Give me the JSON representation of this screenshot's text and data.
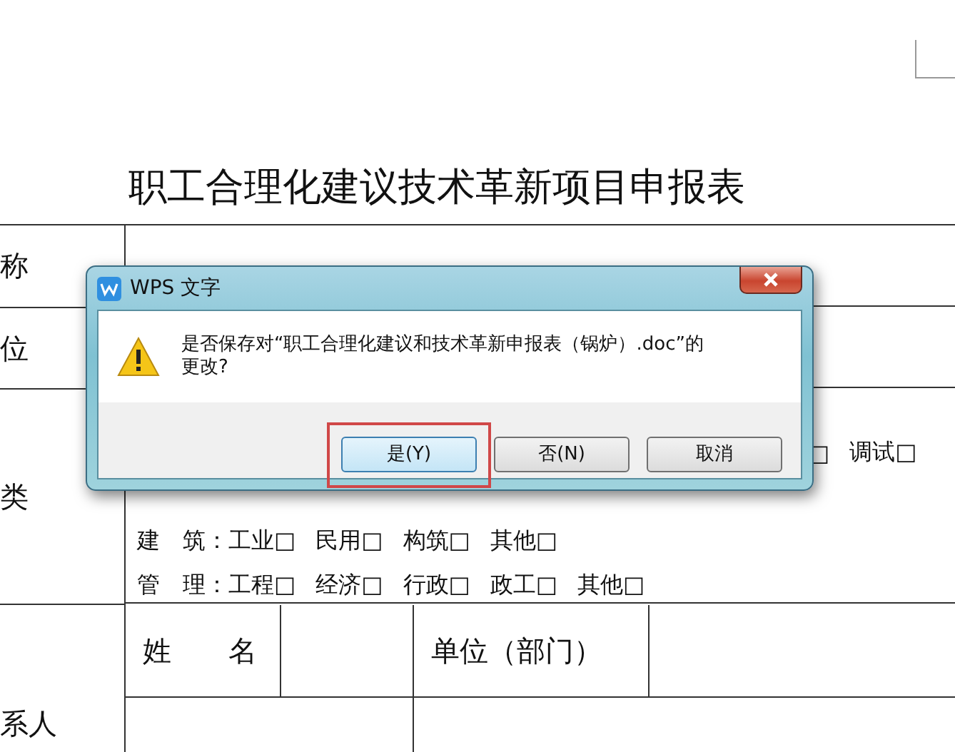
{
  "document": {
    "title": "职工合理化建议技术革新项目申报表",
    "rows": [
      {
        "label": "称"
      },
      {
        "label": "位"
      }
    ],
    "category": {
      "label": "类",
      "first_line": [
        "□",
        "调试□"
      ],
      "lines": [
        {
          "head": "建　筑：",
          "options": [
            "工业□",
            "民用□",
            "构筑□",
            "其他□"
          ]
        },
        {
          "head": "管　理：",
          "options": [
            "工程□",
            "经济□",
            "行政□",
            "政工□",
            "其他□"
          ]
        }
      ]
    },
    "contact": {
      "label": "系人",
      "name_label": "姓　　名",
      "unit_label": "单位（部门）"
    }
  },
  "dialog": {
    "title": "WPS 文字",
    "message": "是否保存对“职工合理化建议和技术革新申报表（锅炉）.doc”的更改?",
    "buttons": [
      {
        "label": "是(Y)",
        "selected": true,
        "highlighted": true
      },
      {
        "label": "否(N)",
        "selected": false,
        "highlighted": false
      },
      {
        "label": "取消",
        "selected": false,
        "highlighted": false
      }
    ]
  }
}
